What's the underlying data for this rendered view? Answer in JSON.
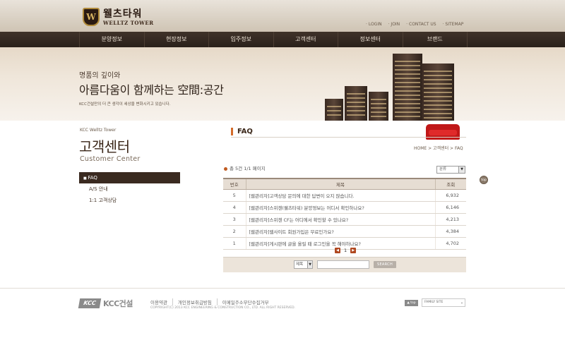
{
  "header": {
    "logo_emblem": "W",
    "logo_ko": "웰츠타워",
    "logo_en": "WELLTZ TOWER",
    "util_links": [
      "LOGIN",
      "JOIN",
      "CONTACT US",
      "SITEMAP"
    ]
  },
  "nav": {
    "items": [
      "분양정보",
      "현장정보",
      "입주정보",
      "고객센터",
      "정보센터",
      "브랜드"
    ]
  },
  "visual": {
    "sub": "명품의 깊이와",
    "main": "아름다움이 함께하는 空間:공간",
    "desc": "KCC건설만의 더 큰 생각이 세상을 변화시키고 있습니다."
  },
  "left": {
    "en_label": "KCC Welltz Tower",
    "ko_title": "고객센터",
    "en_title": "Customer Center",
    "menu": [
      "FAQ",
      "A/S 안내",
      "1:1 고객상담"
    ]
  },
  "content": {
    "title": "FAQ",
    "breadcrumb": "HOME > 고객센터 > FAQ",
    "count_text": "총 5건 1/1 페이지",
    "category_select": "분류",
    "top_button": "top",
    "table": {
      "headers": [
        "번호",
        "제목",
        "조회"
      ],
      "rows": [
        {
          "no": "5",
          "subject": "[웹관리자]고객상담 문의에 대한 답변이 오지 않습니다.",
          "views": "6,932"
        },
        {
          "no": "4",
          "subject": "[웹관리자]스위첸(웰츠타워) 분양정보는 어디서 확인하나요?",
          "views": "6,146"
        },
        {
          "no": "3",
          "subject": "[웹관리자]스위첸 CF는 어디에서 확인할 수 있나요?",
          "views": "4,213"
        },
        {
          "no": "2",
          "subject": "[웹관리자]웹사이트 회원가입은 무료인가요?",
          "views": "4,384"
        },
        {
          "no": "1",
          "subject": "[웹관리자]게시판에 글을 올릴 때 로그인을 꼭 해야하나요?",
          "views": "4,702"
        }
      ]
    },
    "pager": {
      "prev": "◀",
      "current": "1",
      "next": "▶"
    },
    "search": {
      "select": "제목",
      "value": "",
      "button": "SEARCH"
    }
  },
  "footer": {
    "logo_mark": "KCC",
    "logo_text": "KCC건설",
    "links": [
      "이용약관",
      "개인정보취급방침",
      "이메일주소무단수집거부"
    ],
    "copyright": "COPYRIGHT(C) 2013 KCC ENGINEERING & CONSTRUCTION CO., LTD. ALL RIGHT RESERVED.",
    "top": "▲ top",
    "family_site": "FAMILY SITE"
  }
}
